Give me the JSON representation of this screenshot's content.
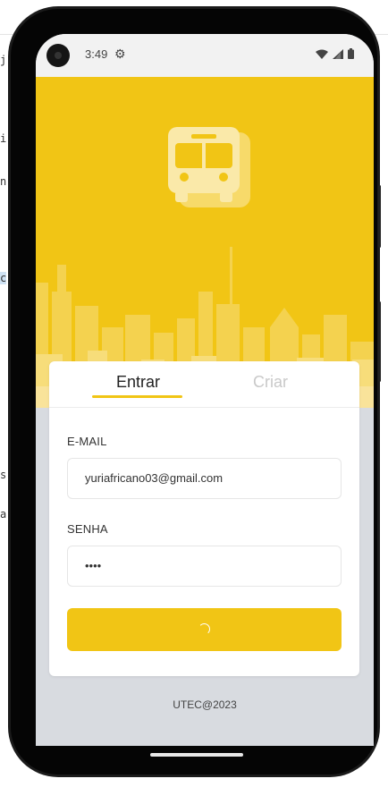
{
  "status_bar": {
    "time": "3:49",
    "settings_icon": "gear-icon",
    "wifi_icon": "wifi-icon",
    "signal_icon": "signal-icon",
    "battery_icon": "battery-icon"
  },
  "hero": {
    "illustration": "bus-icon",
    "background": "city-skyline"
  },
  "tabs": {
    "login": "Entrar",
    "create": "Criar",
    "active": "login"
  },
  "form": {
    "email_label": "E-MAIL",
    "email_value": "yuriafricano03@gmail.com",
    "password_label": "SENHA",
    "password_value": "••••",
    "submit_state": "loading"
  },
  "footer": {
    "text": "UTEC@2023"
  },
  "colors": {
    "accent": "#f1c515",
    "screen_bg": "#d8dbe0"
  }
}
